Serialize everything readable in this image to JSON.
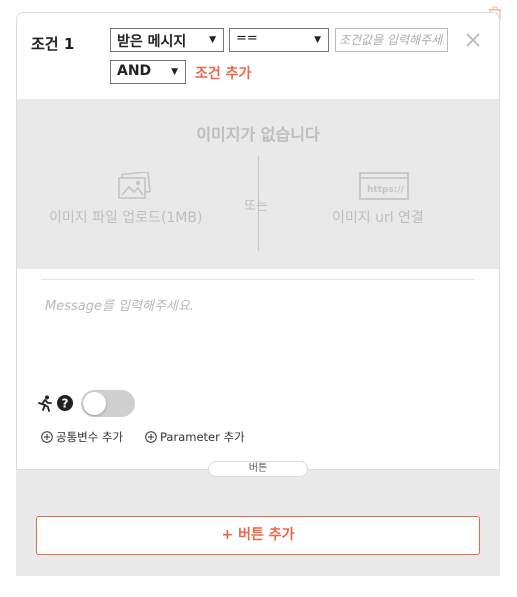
{
  "condition": {
    "label": "조건 1",
    "field_select": "받은 메시지",
    "operator_select": "==",
    "value_placeholder": "조건값을 입력해주세요",
    "logic_select": "AND",
    "add_condition_label": "조건 추가"
  },
  "image": {
    "empty_text": "이미지가 없습니다",
    "or_text": "또는",
    "upload_label": "이미지 파일 업로드(1MB)",
    "url_label": "이미지 url 연결",
    "url_icon_text": "https://"
  },
  "message": {
    "placeholder": "Message를 입력해주세요."
  },
  "links": {
    "common_var": "공통변수 추가",
    "parameter": "Parameter 추가"
  },
  "button_tab": "버튼",
  "add_button_label": "+ 버튼 추가",
  "colors": {
    "accent": "#e8694a",
    "panel_gray": "#e9e9e9",
    "muted_text": "#bdbdbd"
  }
}
